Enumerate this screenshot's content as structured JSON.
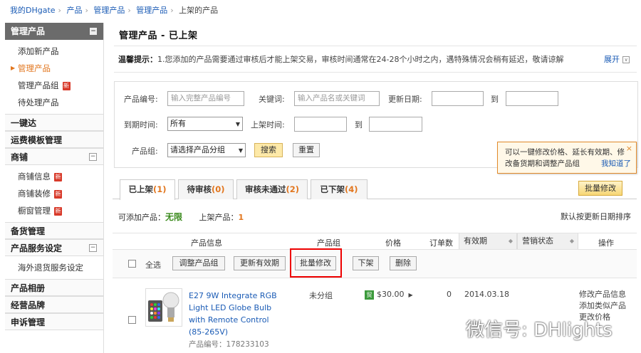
{
  "breadcrumb": [
    "我的DHgate",
    "产品",
    "管理产品",
    "管理产品",
    "上架的产品"
  ],
  "sidebar": {
    "header": "管理产品",
    "header_toggle": "−",
    "product_items": [
      {
        "label": "添加新产品",
        "badge": ""
      },
      {
        "label": "管理产品",
        "badge": "",
        "active": true
      },
      {
        "label": "管理产品组",
        "badge": "新"
      },
      {
        "label": "待处理产品",
        "badge": ""
      }
    ],
    "quick_section": "一键达",
    "shipping_section": "运费模板管理",
    "shop_section": "商铺",
    "shop_toggle": "−",
    "shop_items": [
      {
        "label": "商铺信息",
        "badge": "新"
      },
      {
        "label": "商铺装修",
        "badge": "新"
      },
      {
        "label": "橱窗管理",
        "badge": "新"
      }
    ],
    "stock_section": "备货管理",
    "service_section": "产品服务设定",
    "service_toggle": "−",
    "service_items": [
      {
        "label": "海外退货服务设定"
      }
    ],
    "album_section": "产品相册",
    "brand_section": "经营品牌",
    "complaint_section": "申诉管理"
  },
  "page_title": "管理产品  - 已上架",
  "tip": {
    "label": "温馨提示：",
    "text": "1.您添加的产品需要通过审核后才能上架交易，审核时间通常在24-28个小时之内，遇特殊情况会稍有延迟，敬请谅解",
    "expand": "展开"
  },
  "search": {
    "product_code_label": "产品编号:",
    "product_code_placeholder": "输入完整产品编号",
    "keyword_label": "关键词:",
    "keyword_placeholder": "输入产品名或关键词",
    "update_date_label": "更新日期:",
    "to": "到",
    "expire_label": "到期时间:",
    "expire_value": "所有",
    "list_time_label": "上架时间:",
    "group_label": "产品组:",
    "group_value": "请选择产品分组",
    "search_button": "搜索",
    "reset_button": "重置"
  },
  "popup": {
    "text": "可以一键修改价格、延长有效期、修改备货期和调整产品组",
    "ok": "我知道了",
    "close": "×"
  },
  "tabs": [
    {
      "label": "已上架",
      "count": "(1)",
      "active": true
    },
    {
      "label": "待审核",
      "count": "(0)"
    },
    {
      "label": "审核未通过",
      "count": "(2)"
    },
    {
      "label": "已下架",
      "count": "(4)"
    }
  ],
  "batch_edit_top": "批量修改",
  "stats": {
    "addable_label": "可添加产品：",
    "addable_value": "无限",
    "listed_label": "上架产品：",
    "listed_value": "1",
    "sort_text": "默认按更新日期排序"
  },
  "table_headers": {
    "product_info": "产品信息",
    "group": "产品组",
    "price": "价格",
    "orders": "订单数",
    "validity": "有效期",
    "marketing": "营销状态",
    "actions": "操作"
  },
  "actions_row": {
    "select_all": "全选",
    "adjust_group": "调整产品组",
    "update_validity": "更新有效期",
    "batch_edit": "批量修改",
    "unlist": "下架",
    "delete": "删除"
  },
  "product": {
    "name": "E27 9W Integrate RGB Light LED Globe Bulb with Remote Control (85-265V)",
    "code_label": "产品编号：",
    "code": "178233103",
    "group": "未分组",
    "price_badge": "贸",
    "price": "$30.00",
    "orders": "0",
    "expire_date": "2014.03.18",
    "actions": [
      "修改产品信息",
      "添加类似产品",
      "更改价格"
    ]
  },
  "watermark": "微信号: DHlights"
}
